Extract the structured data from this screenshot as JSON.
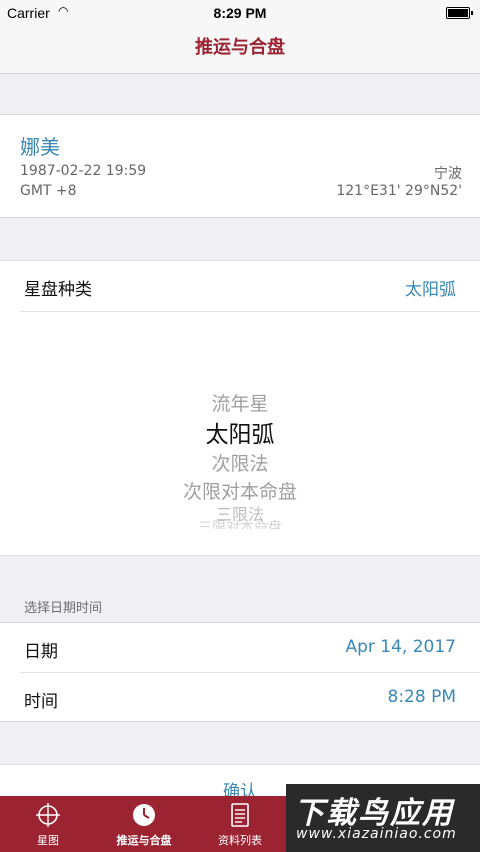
{
  "status_bar": {
    "carrier": "Carrier",
    "wifi_icon": "wifi-icon",
    "time": "8:29 PM",
    "battery_icon": "battery-icon"
  },
  "nav": {
    "title": "推运与合盘"
  },
  "profile": {
    "name": "娜美",
    "datetime": "1987-02-22 19:59",
    "timezone": "GMT +8",
    "city": "宁波",
    "coordinates": "121°E31' 29°N52'"
  },
  "chart_type": {
    "label": "星盘种类",
    "value": "太阳弧",
    "picker_options": [
      "流年星",
      "太阳弧",
      "次限法",
      "次限对本命盘",
      "三限法",
      "三限对本命盘"
    ],
    "selected_index": 1
  },
  "date_section": {
    "header": "选择日期时间",
    "date_label": "日期",
    "date_value": "Apr 14, 2017",
    "time_label": "时间",
    "time_value": "8:28 PM"
  },
  "confirm": {
    "label": "确认"
  },
  "tab_bar": {
    "items": [
      {
        "label": "星图",
        "icon": "crosshair-chart-icon"
      },
      {
        "label": "推运与合盘",
        "icon": "clock-icon"
      },
      {
        "label": "资料列表",
        "icon": "document-list-icon"
      },
      {
        "label": "",
        "icon": "tab-icon"
      },
      {
        "label": "",
        "icon": "tab-icon"
      }
    ],
    "active_index": 1,
    "color": "#9b2332"
  },
  "watermark": {
    "main": "下载鸟应用",
    "url": "www.xiazainiao.com"
  },
  "colors": {
    "accent": "#3a88b5",
    "brand": "#9b2332",
    "background": "#efeff4"
  }
}
